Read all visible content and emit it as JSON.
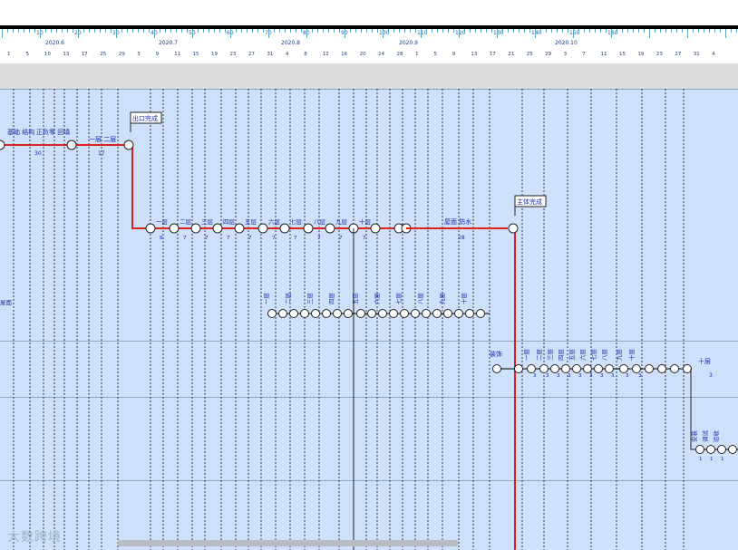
{
  "timescale": {
    "ruler_numbers": [
      "10",
      "20",
      "30",
      "40",
      "50",
      "60",
      "70",
      "80",
      "90",
      "100",
      "110",
      "120",
      "130",
      "140",
      "150",
      "160"
    ],
    "months": [
      "2020.6",
      "2020.7",
      "2020.8",
      "2020.9",
      "2020.10"
    ],
    "days": [
      "1",
      "5",
      "10",
      "13",
      "17",
      "25",
      "29",
      "3",
      "9",
      "11",
      "15",
      "19",
      "23",
      "27",
      "31",
      "4",
      "8",
      "12",
      "16",
      "20",
      "24",
      "28",
      "1",
      "5",
      "9",
      "13",
      "17",
      "21",
      "25",
      "29",
      "3",
      "7",
      "11",
      "15",
      "19",
      "23",
      "27",
      "31",
      "4"
    ]
  },
  "network": {
    "milestone_top": "出口完成",
    "milestone_mid": "主体完成",
    "label_row1_a": "基础 结构",
    "label_row1_b": "正负零 回填",
    "duration_row1_a": "30",
    "label_row1_c": "一层 二层",
    "duration_row1_c": "17",
    "floors": [
      "一层",
      "二层",
      "三层",
      "四层",
      "五层",
      "六层",
      "七层",
      "八层",
      "九层",
      "十层"
    ],
    "floor_durations": [
      "8",
      "7",
      "7",
      "7",
      "7",
      "7",
      "7",
      "7",
      "7",
      "7"
    ],
    "roof_label": "屋面 防水",
    "roof_duration": "28",
    "inner_labels": [
      "一层",
      "二层",
      "三层",
      "四层",
      "五层",
      "六层",
      "七层",
      "八层",
      "九层",
      "十层",
      "屋面"
    ],
    "inner_duration": "1",
    "decor_labels": [
      "一层",
      "二层",
      "三层",
      "四层",
      "五层",
      "六层",
      "七层",
      "八层",
      "九层",
      "十层"
    ],
    "decor_start": "装饰",
    "decor_end": "十层",
    "decor_end_duration": "3",
    "decor_duration": "3",
    "install_labels": [
      "安装",
      "调试",
      "验收"
    ],
    "install_duration": "1"
  },
  "watermark": "大数跨境",
  "colors": {
    "critical": "#e0201b",
    "normal": "#000000",
    "text": "#1a2ea8",
    "grid": "#000000",
    "canvas": "#cfe0fb"
  }
}
